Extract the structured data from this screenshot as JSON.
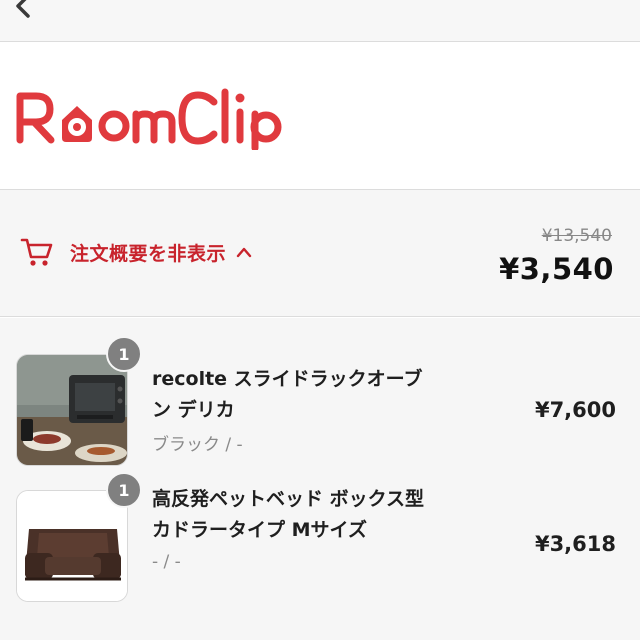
{
  "nav": {
    "back_icon": "chevron-left-icon"
  },
  "brand": {
    "logo_text": "RoomClip",
    "color": "#e03a3e"
  },
  "summary": {
    "toggle_label": "注文概要を非表示",
    "cart_icon": "cart-icon",
    "chevron_icon": "chevron-up-icon",
    "original_total": "¥13,540",
    "total": "¥3,540",
    "accent_color": "#c8232c"
  },
  "items": [
    {
      "quantity": "1",
      "name_line1": "recolte スライドラックオーブ",
      "name_line2": "ン デリカ",
      "variant": "ブラック / -",
      "price": "¥7,600"
    },
    {
      "quantity": "1",
      "name_line1": "高反発ペットベッド ボックス型",
      "name_line2": "カドラータイプ Mサイズ",
      "variant": "- / -",
      "price": "¥3,618"
    }
  ]
}
